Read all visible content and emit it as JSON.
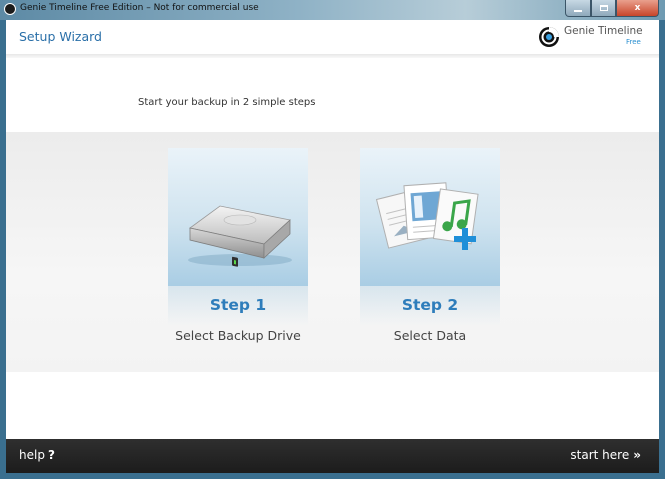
{
  "window": {
    "title": "Genie Timeline Free Edition – Not for commercial use",
    "controls": {
      "close_glyph": "x"
    }
  },
  "header": {
    "page_title": "Setup Wizard",
    "brand_name": "Genie Timeline",
    "brand_edition": "Free"
  },
  "intro_text": "Start your backup in 2 simple steps",
  "steps": [
    {
      "number_label": "Step 1",
      "label": "Select Backup Drive",
      "icon": "hard-drive-icon"
    },
    {
      "number_label": "Step 2",
      "label": "Select Data",
      "icon": "data-files-icon"
    }
  ],
  "footer": {
    "help_label": "help",
    "help_glyph": "?",
    "start_label": "start here",
    "start_glyph": "»"
  },
  "colors": {
    "accent_blue": "#2e7dbb",
    "footer_bg": "#1c1c1c",
    "close_red": "#c8452a"
  }
}
